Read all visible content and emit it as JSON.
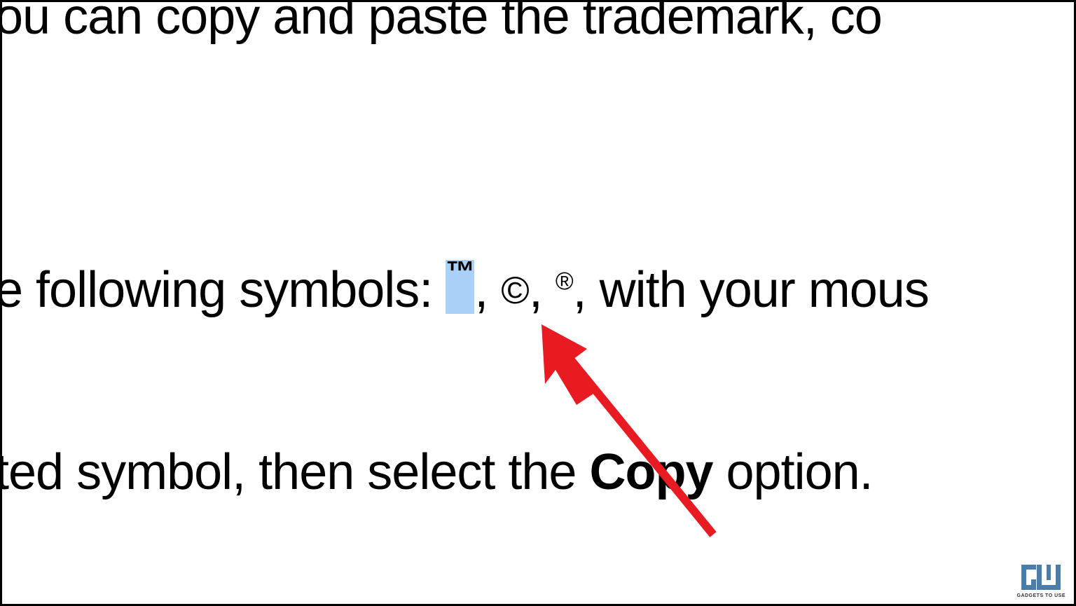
{
  "document": {
    "line1": "ou can copy and paste the trademark, co",
    "line2_prefix": "e following symbols: ",
    "line2_tm": "™",
    "line2_mid1": ", ",
    "line2_copyright": "©",
    "line2_mid2": ", ",
    "line2_registered": "®",
    "line2_suffix": ", with your mous",
    "line3_prefix": "ted symbol, then select the ",
    "line3_bold": "Copy",
    "line3_suffix": " option."
  },
  "annotation": {
    "arrow_color": "#e81b23",
    "highlight_color": "#abd0f7"
  },
  "watermark": {
    "brand": "GU",
    "tagline": "GADGETS TO USE"
  }
}
